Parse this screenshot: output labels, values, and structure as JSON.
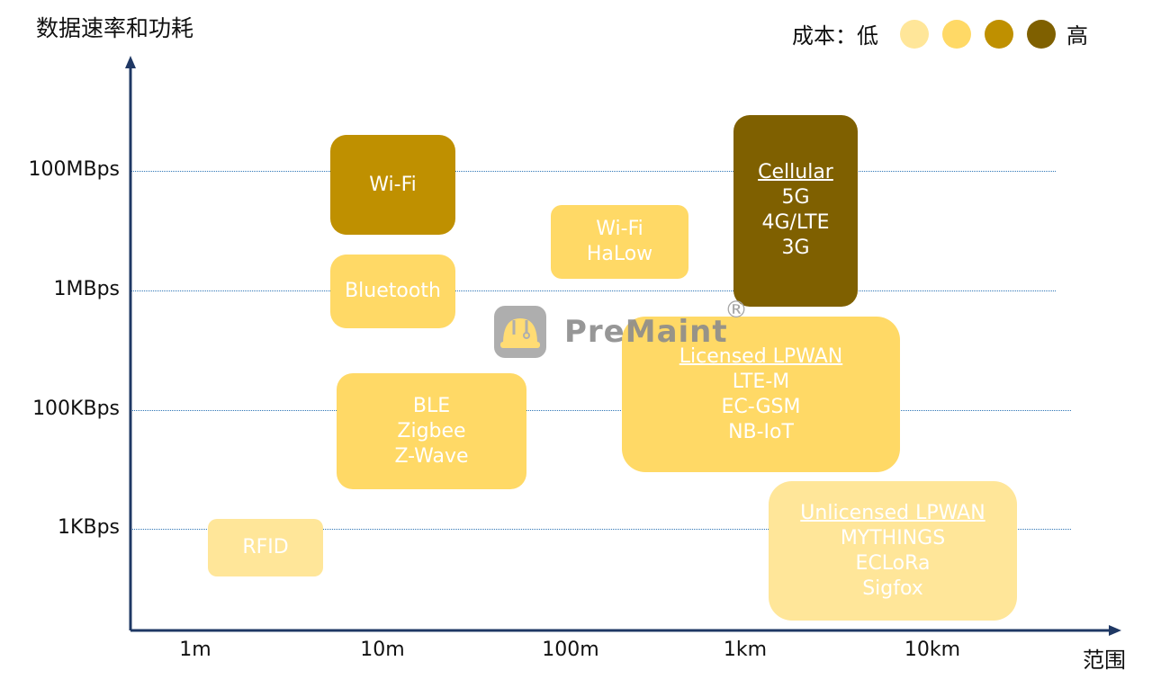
{
  "title": "数据速率和功耗",
  "legend": {
    "label": "成本：低",
    "high_label": "高",
    "colors": [
      "#FFE699",
      "#FFD966",
      "#BF9000",
      "#7F6000"
    ]
  },
  "y_axis": {
    "ticks": [
      "100MBps",
      "1MBps",
      "100KBps",
      "1KBps"
    ]
  },
  "x_axis": {
    "label": "范围",
    "ticks": [
      "1m",
      "10m",
      "100m",
      "1km",
      "10km"
    ]
  },
  "boxes": [
    {
      "heading": "",
      "lines": [
        "Wi-Fi"
      ],
      "color": "#BF9000"
    },
    {
      "heading": "",
      "lines": [
        "Bluetooth"
      ],
      "color": "#FFD966"
    },
    {
      "heading": "",
      "lines": [
        "Wi-Fi",
        "HaLow"
      ],
      "color": "#FFD966"
    },
    {
      "heading": "Cellular",
      "lines": [
        "5G",
        "4G/LTE",
        "3G"
      ],
      "color": "#7F6000"
    },
    {
      "heading": "Licensed LPWAN",
      "lines": [
        "LTE-M",
        "EC-GSM",
        "NB-IoT"
      ],
      "color": "#FFD966"
    },
    {
      "heading": "",
      "lines": [
        "BLE",
        "Zigbee",
        "Z-Wave"
      ],
      "color": "#FFD966"
    },
    {
      "heading": "",
      "lines": [
        "RFID"
      ],
      "color": "#FFE699"
    },
    {
      "heading": "Unlicensed LPWAN",
      "lines": [
        "MYTHINGS",
        "ECLoRa",
        "Sigfox"
      ],
      "color": "#FFE699"
    }
  ],
  "watermark": {
    "text": "PreMaint",
    "mark": "®"
  }
}
